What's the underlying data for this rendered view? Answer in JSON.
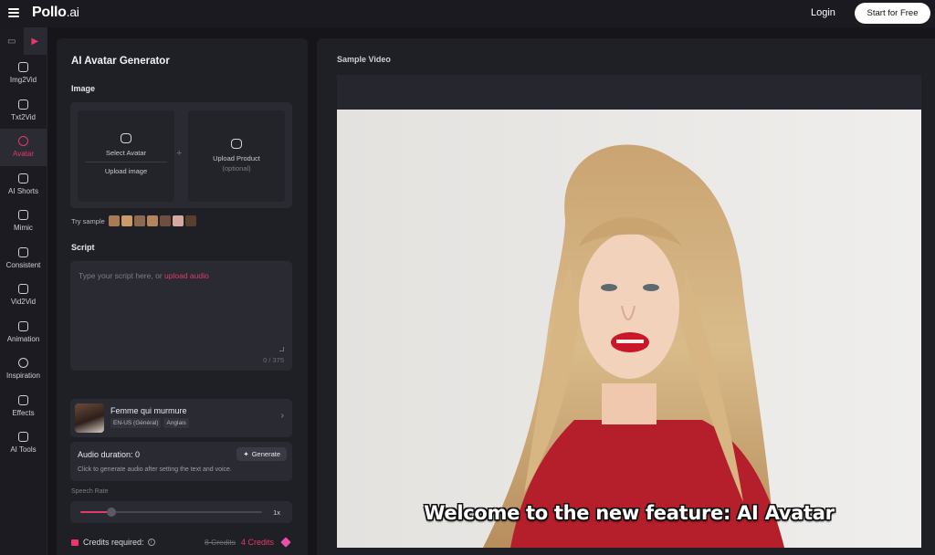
{
  "header": {
    "logo": "Pollo",
    "logo_suffix": ".ai",
    "login": "Login",
    "start": "Start for Free"
  },
  "rail": {
    "top_icons": [
      "image-icon",
      "video-icon"
    ],
    "items": [
      {
        "label": "Img2Vid",
        "icon": "img2vid-icon"
      },
      {
        "label": "Txt2Vid",
        "icon": "txt2vid-icon"
      },
      {
        "label": "Avatar",
        "icon": "avatar-icon",
        "active": true
      },
      {
        "label": "AI Shorts",
        "icon": "shorts-icon"
      },
      {
        "label": "Mimic",
        "icon": "mimic-icon"
      },
      {
        "label": "Consistent",
        "icon": "consistent-icon"
      },
      {
        "label": "Vid2Vid",
        "icon": "vid2vid-icon"
      },
      {
        "label": "Animation",
        "icon": "animation-icon"
      },
      {
        "label": "Inspiration",
        "icon": "compass-icon"
      },
      {
        "label": "Effects",
        "icon": "effects-icon"
      },
      {
        "label": "AI Tools",
        "icon": "tools-icon"
      }
    ]
  },
  "panel": {
    "title": "AI Avatar Generator",
    "image_label": "Image",
    "select_avatar": "Select Avatar",
    "upload_image": "Upload image",
    "upload_product": "Upload Product",
    "optional": "(optional)",
    "try_sample": "Try sample",
    "script_label": "Script",
    "script_placeholder": "Type your script here, or ",
    "upload_audio": "upload audio",
    "char_count": "0 / 375",
    "voice_name": "Femme qui murmure",
    "voice_tag_1": "EN-US (Général)",
    "voice_tag_2": "Anglais",
    "audio_duration": "Audio duration: 0",
    "generate": "Generate",
    "audio_hint": "Click to generate audio after setting the text and voice.",
    "speech_rate_label": "Speech Rate",
    "speech_rate": "1x",
    "speech_rate_fraction": 0.17,
    "credits_label": "Credits required:",
    "credits_old": "8 Credits",
    "credits_new": "4 Credits"
  },
  "main": {
    "sample_label": "Sample Video",
    "subtitle": "Welcome to the new feature: AI Avatar"
  },
  "colors": {
    "accent": "#e5396b",
    "panel": "#1f1f26",
    "background": "#15151a"
  }
}
